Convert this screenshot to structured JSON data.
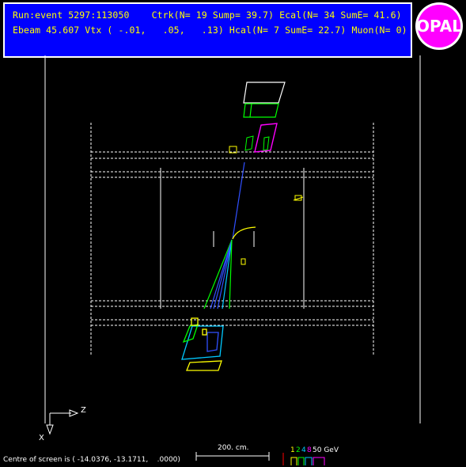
{
  "header": {
    "line1": "Run:event 5297:113050    Ctrk(N= 19 Sump= 39.7) Ecal(N= 34 SumE= 41.6)",
    "line2": "Ebeam 45.607 Vtx ( -.01,   .05,   .13) Hcal(N= 7 SumE= 22.7) Muon(N= 0)"
  },
  "logo": {
    "text": "OPAL",
    "color": "#ff00ff"
  },
  "axes": {
    "z_label": "Z",
    "x_label": "X"
  },
  "scale": {
    "label": "200. cm."
  },
  "energy_legend": {
    "values": [
      "1",
      "2",
      "4",
      "8",
      "50 GeV"
    ],
    "colors": [
      "#ffff00",
      "#00ff00",
      "#00ffff",
      "#ff00ff",
      "#ffffff"
    ]
  },
  "footer": {
    "centre_text": "Centre of screen is ( -14.0376, -13.1711,    .0000)"
  },
  "colors": {
    "header_bg": "#0000ff",
    "header_text": "#ffff00",
    "track_blue": "#3050ff",
    "track_green": "#00ff00",
    "track_yellow": "#ffff00",
    "cluster_magenta": "#ff00ff",
    "cluster_cyan": "#00c8ff"
  }
}
